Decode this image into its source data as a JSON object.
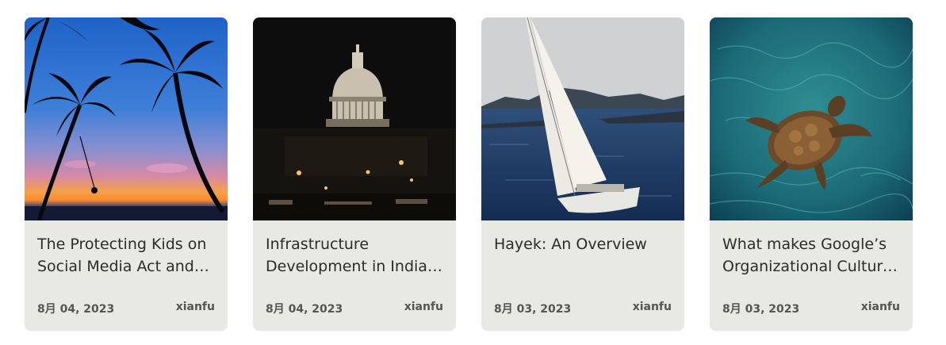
{
  "cards": [
    {
      "image": "palm-beach-sunset",
      "title": "The Protecting Kids on Social Media Act and the Future of Online Safety",
      "date": "8月 04, 2023",
      "author": "xianfu"
    },
    {
      "image": "capitol-dome-night",
      "title": "Infrastructure Development in India and its Economic Impact",
      "date": "8月 04, 2023",
      "author": "xianfu"
    },
    {
      "image": "sailboat-on-sea",
      "title": "Hayek: An Overview",
      "date": "8月 03, 2023",
      "author": "xianfu"
    },
    {
      "image": "sea-turtle-underwater",
      "title": "What makes Google’s Organizational Culture Unique",
      "date": "8月 03, 2023",
      "author": "xianfu"
    }
  ]
}
